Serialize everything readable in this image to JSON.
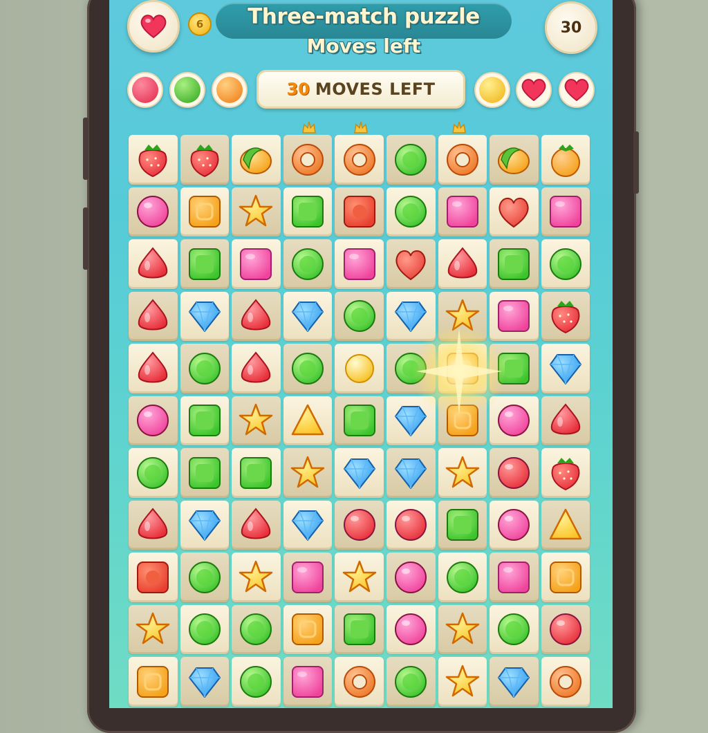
{
  "header": {
    "title": "Three-match puzzle",
    "subtitle": "Moves left",
    "corner_badge": "30",
    "coin_label": "6"
  },
  "status_bar": {
    "moves_number": "30",
    "moves_label": "MOVES LEFT",
    "left_orbs": [
      "red-orb",
      "green-orb",
      "orange-orb"
    ],
    "right_items": [
      "gold-orb",
      "heart",
      "heart"
    ]
  },
  "colors": {
    "red": "#e8303a",
    "green": "#3cc42c",
    "pink": "#f0449c",
    "orange": "#f5a11a",
    "blue": "#2f9cf0",
    "yellow": "#fbc52a",
    "magenta": "#e83c9a"
  },
  "board": {
    "columns": 9,
    "rows": [
      [
        "strawberry",
        "strawberry",
        "fruit-slice",
        "donut",
        "donut",
        "green-gem",
        "donut",
        "fruit-slice",
        "orange-fruit"
      ],
      [
        "pink-gem",
        "orange-square",
        "orange-star",
        "green-square",
        "red-square",
        "green-gem",
        "pink-square",
        "red-heart",
        "pink-square"
      ],
      [
        "red-drop",
        "green-square",
        "pink-square",
        "green-gem",
        "pink-square",
        "red-heart",
        "red-drop",
        "green-square",
        "green-gem"
      ],
      [
        "red-drop",
        "blue-diamond",
        "red-drop",
        "blue-diamond",
        "green-gem",
        "blue-diamond",
        "orange-star",
        "pink-square",
        "strawberry-red"
      ],
      [
        "red-drop",
        "green-gem",
        "red-drop",
        "green-gem",
        "gold-burst",
        "green-gem",
        "orange-square",
        "green-square",
        "blue-diamond"
      ],
      [
        "pink-gem",
        "green-square",
        "orange-star",
        "orange-triangle",
        "green-square",
        "blue-diamond",
        "orange-square",
        "pink-gem",
        "red-drop"
      ],
      [
        "green-gem",
        "green-square",
        "green-square",
        "orange-star",
        "blue-diamond",
        "blue-diamond",
        "orange-star",
        "red-gem",
        "strawberry"
      ],
      [
        "red-drop",
        "blue-diamond",
        "red-drop",
        "blue-diamond",
        "red-gem",
        "red-gem",
        "green-square",
        "pink-gem",
        "orange-triangle"
      ],
      [
        "red-square",
        "green-gem",
        "orange-star-square",
        "pink-square",
        "orange-star",
        "pink-gem",
        "green-gem",
        "pink-square",
        "orange-square"
      ],
      [
        "orange-star",
        "green-gem",
        "green-gem",
        "orange-square",
        "green-square",
        "pink-gem",
        "orange-star",
        "green-gem",
        "red-gem"
      ],
      [
        "orange-square",
        "blue-diamond",
        "green-gem",
        "pink-square",
        "donut",
        "green-gem",
        "orange-star",
        "blue-diamond",
        "donut"
      ]
    ]
  }
}
